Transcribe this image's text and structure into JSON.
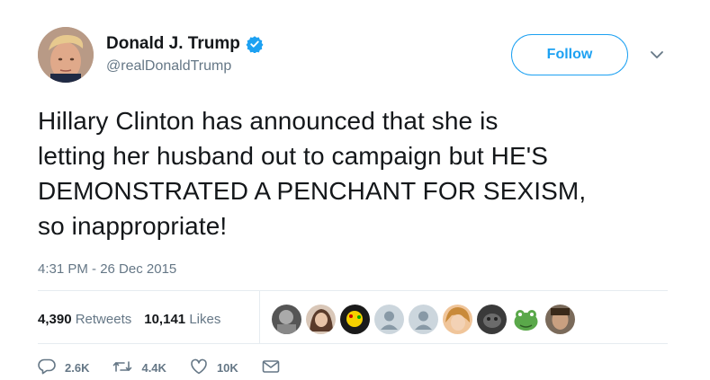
{
  "author": {
    "display_name": "Donald J. Trump",
    "handle": "@realDonaldTrump",
    "verified": true
  },
  "follow_button": {
    "label": "Follow"
  },
  "tweet": {
    "lines": [
      "Hillary Clinton has announced that she is",
      "letting her husband out to campaign but HE'S",
      "DEMONSTRATED A PENCHANT FOR SEXISM,",
      "so inappropriate!"
    ],
    "timestamp": "4:31 PM - 26 Dec 2015"
  },
  "stats": {
    "retweets_count": "4,390",
    "retweets_label": "Retweets",
    "likes_count": "10,141",
    "likes_label": "Likes"
  },
  "likers": [
    "liker-avatar",
    "liker-avatar",
    "liker-avatar",
    "default-egg-avatar",
    "default-egg-avatar",
    "liker-avatar",
    "liker-avatar",
    "frog-avatar",
    "liker-avatar"
  ],
  "actions": {
    "reply_count": "2.6K",
    "retweet_count": "4.4K",
    "like_count": "10K"
  },
  "colors": {
    "accent": "#1da1f2",
    "muted": "#657786",
    "text": "#14171a",
    "divider": "#e6ecf0"
  }
}
